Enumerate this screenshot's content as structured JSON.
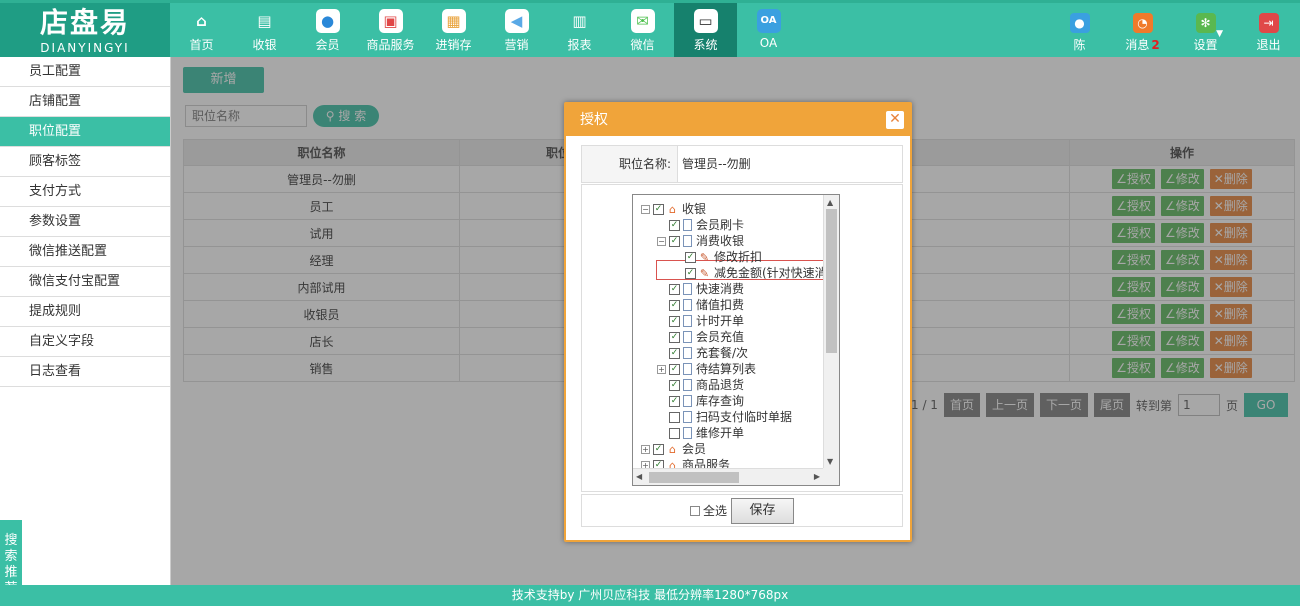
{
  "logo": {
    "cn": "店盘易",
    "en": "DIANYINGYI"
  },
  "nav": [
    {
      "label": "首页",
      "icon": "home-icon",
      "color": "#ffffff",
      "glyph": "⌂"
    },
    {
      "label": "收银",
      "icon": "cash-register-icon",
      "color": "#ffffff",
      "glyph": "▤"
    },
    {
      "label": "会员",
      "icon": "member-icon",
      "color": "#2a88d8",
      "glyph": "●"
    },
    {
      "label": "商品服务",
      "icon": "product-icon",
      "color": "#e04848",
      "glyph": "▣"
    },
    {
      "label": "进销存",
      "icon": "inventory-icon",
      "color": "#e8a23a",
      "glyph": "▦"
    },
    {
      "label": "营销",
      "icon": "marketing-icon",
      "color": "#5aa9e6",
      "glyph": "◀"
    },
    {
      "label": "报表",
      "icon": "report-icon",
      "color": "#ffffff",
      "glyph": "▥"
    },
    {
      "label": "微信",
      "icon": "wechat-icon",
      "color": "#4fc14f",
      "glyph": "✉"
    },
    {
      "label": "系统",
      "icon": "monitor-icon",
      "color": "#333333",
      "glyph": "▭"
    },
    {
      "label": "OA",
      "icon": "oa-icon",
      "color": "#3aa0e0",
      "glyph": "OA"
    }
  ],
  "right_nav": [
    {
      "label": "陈",
      "icon": "user-icon",
      "color": "#3aa0e0",
      "glyph": "●"
    },
    {
      "label": "消息",
      "icon": "message-icon",
      "color": "#f07a2a",
      "glyph": "◔",
      "badge": "2"
    },
    {
      "label": "设置",
      "icon": "settings-icon",
      "color": "#5ab84f",
      "glyph": "✻"
    },
    {
      "label": "退出",
      "icon": "logout-icon",
      "color": "#e04848",
      "glyph": "⇥"
    }
  ],
  "sidebar": [
    {
      "label": "员工配置",
      "active": false
    },
    {
      "label": "店铺配置",
      "active": false
    },
    {
      "label": "职位配置",
      "active": true
    },
    {
      "label": "顾客标签",
      "active": false
    },
    {
      "label": "支付方式",
      "active": false
    },
    {
      "label": "参数设置",
      "active": false
    },
    {
      "label": "微信推送配置",
      "active": false
    },
    {
      "label": "微信支付宝配置",
      "active": false
    },
    {
      "label": "提成规则",
      "active": false
    },
    {
      "label": "自定义字段",
      "active": false
    },
    {
      "label": "日志查看",
      "active": false
    }
  ],
  "search_tab": "搜索推荐",
  "main": {
    "add_button": "新增",
    "search_placeholder": "职位名称",
    "search_button": "搜 索",
    "columns": [
      "职位名称",
      "职位",
      "操作"
    ],
    "rows": [
      "管理员--勿删",
      "员工",
      "试用",
      "经理",
      "内部试用",
      "收银员",
      "店长",
      "销售"
    ],
    "ops": {
      "auth": "授权",
      "edit": "修改",
      "delete": "删除"
    },
    "pager": {
      "page_info": "1 / 1",
      "first": "首页",
      "prev": "上一页",
      "next": "下一页",
      "last": "尾页",
      "goto_label": "转到第",
      "goto_value": "1",
      "page_unit": "页",
      "go": "GO"
    }
  },
  "footer": "技术支持by 广州贝应科技    最低分辨率1280*768px",
  "modal": {
    "title": "授权",
    "field_label": "职位名称:",
    "field_value": "管理员--勿删",
    "tree": [
      {
        "label": "收银",
        "exp": "⊟",
        "checked": true,
        "icon": "house"
      },
      {
        "label": "会员刷卡",
        "exp": "",
        "checked": true,
        "icon": "page"
      },
      {
        "label": "消费收银",
        "exp": "⊟",
        "checked": true,
        "icon": "page"
      },
      {
        "label": "修改折扣",
        "exp": "",
        "checked": true,
        "icon": "pen"
      },
      {
        "label": "减免金额(针对快速消费)",
        "exp": "",
        "checked": true,
        "icon": "pen"
      },
      {
        "label": "快速消费",
        "exp": "",
        "checked": true,
        "icon": "page"
      },
      {
        "label": "储值扣费",
        "exp": "",
        "checked": true,
        "icon": "page"
      },
      {
        "label": "计时开单",
        "exp": "",
        "checked": true,
        "icon": "page"
      },
      {
        "label": "会员充值",
        "exp": "",
        "checked": true,
        "icon": "page"
      },
      {
        "label": "充套餐/次",
        "exp": "",
        "checked": true,
        "icon": "page"
      },
      {
        "label": "待结算列表",
        "exp": "⊞",
        "checked": true,
        "icon": "page"
      },
      {
        "label": "商品退货",
        "exp": "",
        "checked": true,
        "icon": "page"
      },
      {
        "label": "库存查询",
        "exp": "",
        "checked": true,
        "icon": "page"
      },
      {
        "label": "扫码支付临时单据",
        "exp": "",
        "checked": false,
        "icon": "page"
      },
      {
        "label": "维修开单",
        "exp": "",
        "checked": false,
        "icon": "page"
      },
      {
        "label": "会员",
        "exp": "⊞",
        "checked": true,
        "icon": "house"
      },
      {
        "label": "商品服务",
        "exp": "⊞",
        "checked": true,
        "icon": "house"
      }
    ],
    "select_all": "全选",
    "save": "保存"
  }
}
